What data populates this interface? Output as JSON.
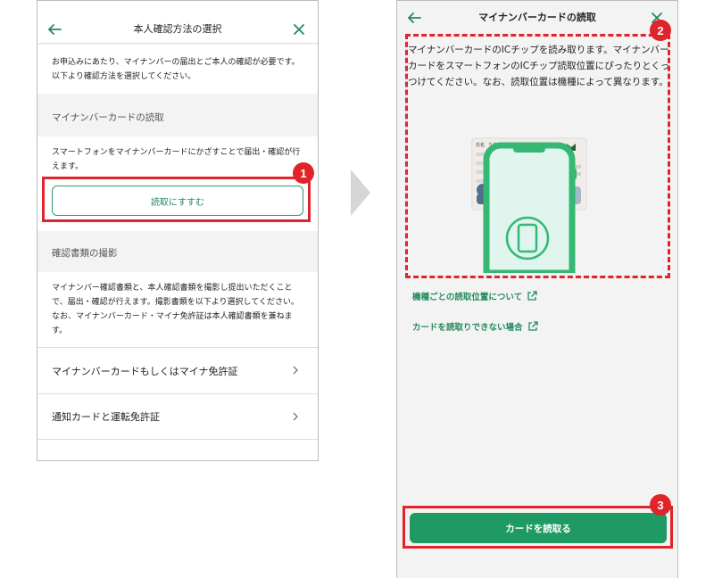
{
  "left_screen": {
    "header_title": "本人確認方法の選択",
    "intro_text": "お申込みにあたり、マイナンバーの届出とご本人の確認が必要です。以下より確認方法を選択してください。",
    "section1_label": "マイナンバーカードの読取",
    "section1_text": "スマートフォンをマイナンバーカードにかざすことで届出・確認が行えます。",
    "read_button_label": "読取にすすむ",
    "section2_label": "確認書類の撮影",
    "section2_text": "マイナンバー確認書類と、本人確認書類を撮影し提出いただくことで、届出・確認が行えます。撮影書類を以下より選択してください。なお、マイナンバーカード・マイナ免許証は本人確認書類を兼ねます。",
    "menu_items": [
      {
        "label": "マイナンバーカードもしくはマイナ免許証"
      },
      {
        "label": "通知カードと運転免許証"
      }
    ]
  },
  "right_screen": {
    "header_title": "マイナンバーカードの読取",
    "description": "マイナンバーカードのICチップを読み取ります。マイナンバーカードをスマートフォンのICチップ読取位置にぴったりとくっつけてください。なお、読取位置は機種によって異なります。",
    "links": [
      {
        "label": "機種ごとの読取位置について"
      },
      {
        "label": "カードを読取りできない場合"
      }
    ],
    "primary_button_label": "カードを読取る"
  },
  "card_text": {
    "name_label": "氏名",
    "name_value": "りそな　太郎"
  },
  "badges": [
    "1",
    "2",
    "3"
  ],
  "colors": {
    "accent_green": "#1f9a64",
    "highlight_red": "#e0242a",
    "phone_green": "#34b873"
  },
  "icons": [
    "back-arrow-icon",
    "close-icon",
    "chevron-right-icon",
    "external-link-icon",
    "flow-arrow-icon"
  ]
}
